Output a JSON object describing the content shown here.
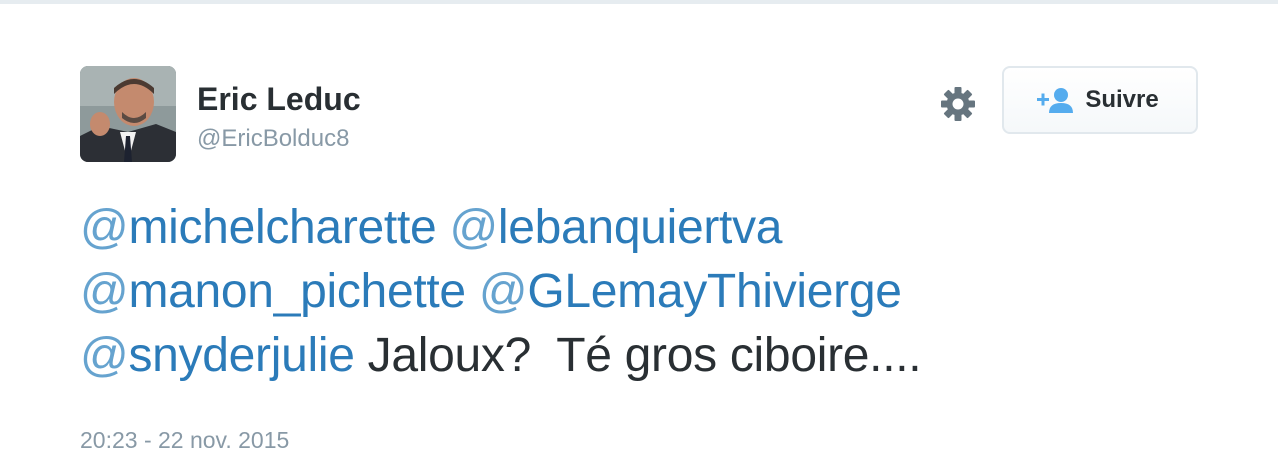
{
  "author": {
    "fullname": "Eric Leduc",
    "username": "@EricBolduc8"
  },
  "actions": {
    "follow_label": "Suivre",
    "settings_icon": "gear-icon",
    "follow_icon": "add-user-icon"
  },
  "tweet": {
    "mentions": [
      {
        "at": "@",
        "name": "michelcharette"
      },
      {
        "at": "@",
        "name": "lebanquiertva"
      },
      {
        "at": "@",
        "name": "manon_pichette"
      },
      {
        "at": "@",
        "name": "GLemayThivierge"
      },
      {
        "at": "@",
        "name": "snyderjulie"
      }
    ],
    "body": "Jaloux?  Té gros ciboire....",
    "timestamp": "20:23 - 22 nov. 2015"
  },
  "colors": {
    "link": "#2b7bb9",
    "text": "#292f33",
    "muted": "#8899a6",
    "border": "#e1e8ed",
    "follow_icon": "#55acee"
  }
}
